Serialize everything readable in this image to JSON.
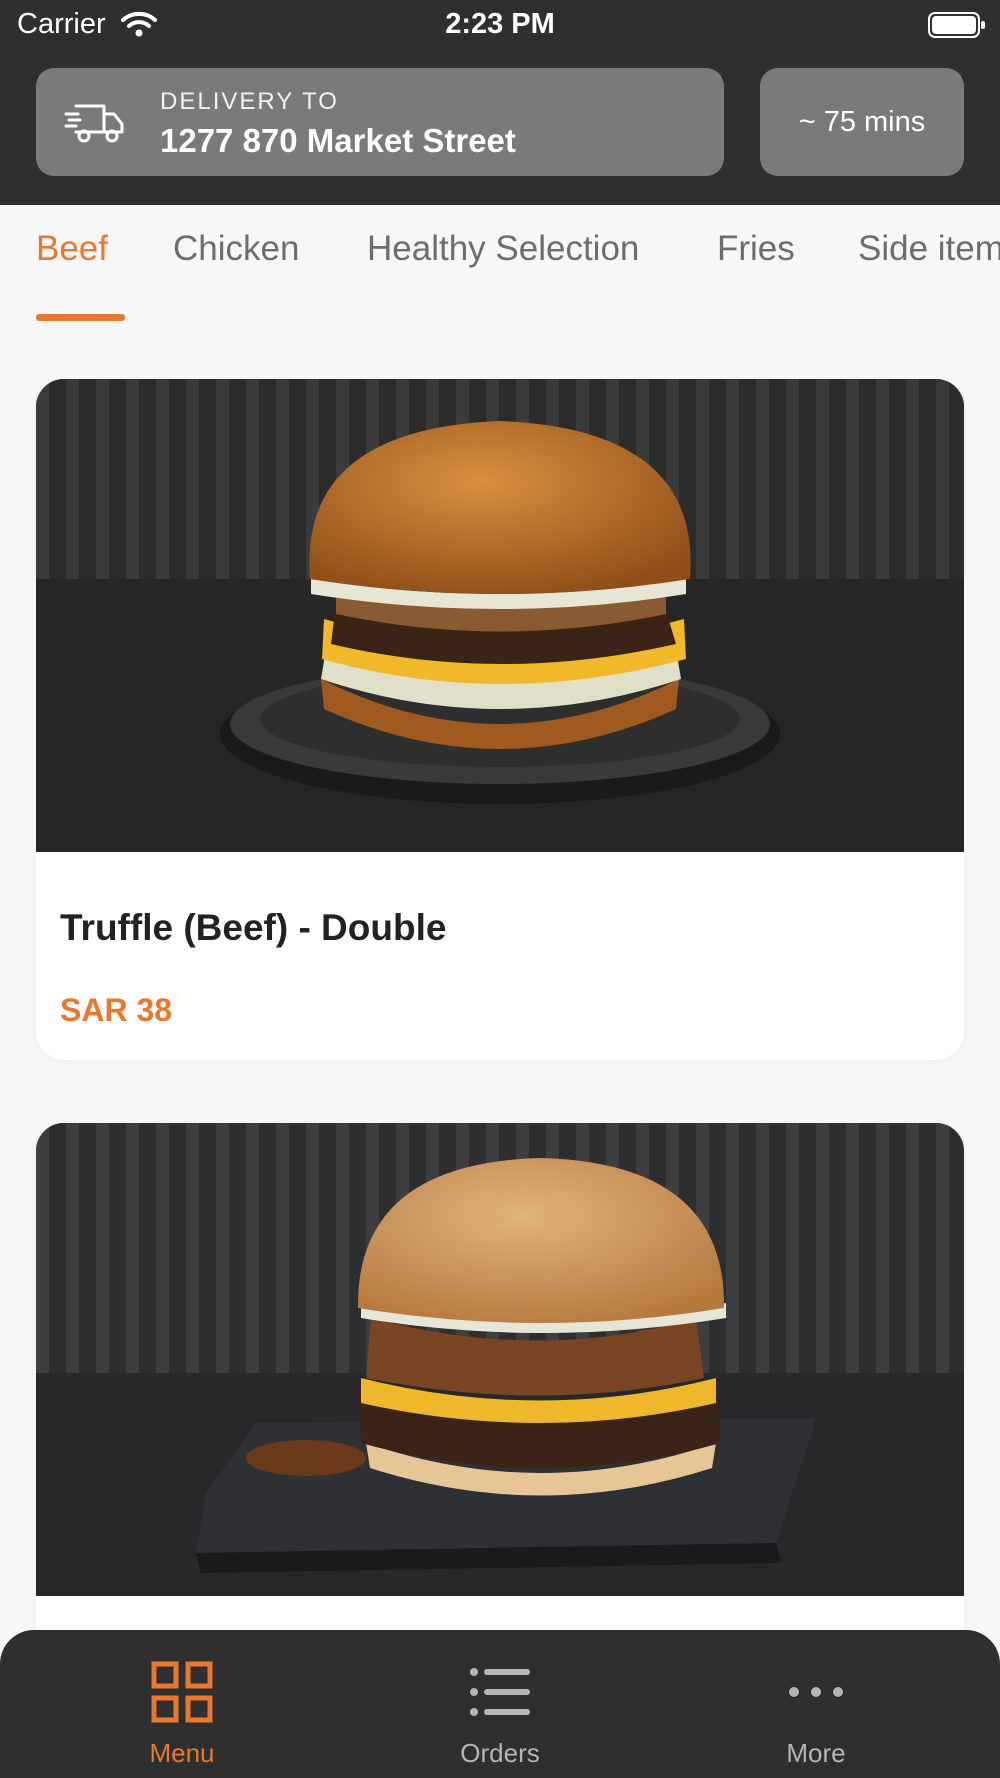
{
  "status_bar": {
    "carrier": "Carrier",
    "time": "2:23 PM"
  },
  "header": {
    "delivery_label": "DELIVERY TO",
    "delivery_address": "1277 870 Market Street",
    "eta": "~ 75 mins",
    "icon": "truck-icon"
  },
  "tabs": [
    {
      "label": "Beef",
      "active": true
    },
    {
      "label": "Chicken"
    },
    {
      "label": "Healthy Selection"
    },
    {
      "label": "Fries"
    },
    {
      "label": "Side item"
    }
  ],
  "menu_items": [
    {
      "title": "Truffle (Beef) - Double",
      "price": "SAR 38",
      "image": "burger-on-plate"
    },
    {
      "title": "",
      "price": "",
      "image": "burger-on-board"
    }
  ],
  "bottom_nav": [
    {
      "label": "Menu",
      "icon": "grid-icon",
      "active": true
    },
    {
      "label": "Orders",
      "icon": "list-icon"
    },
    {
      "label": "More",
      "icon": "more-icon"
    }
  ],
  "colors": {
    "accent": "#e8782d",
    "header": "#2f2f2f",
    "background": "#f7f7f7"
  }
}
